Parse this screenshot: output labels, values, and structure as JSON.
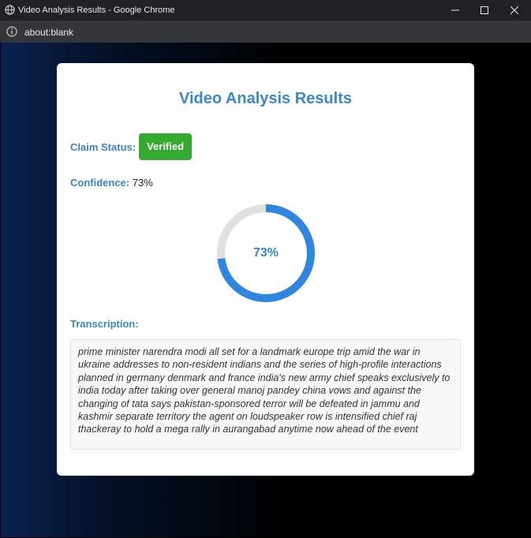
{
  "window": {
    "title": "Video Analysis Results - Google Chrome",
    "address": "about:blank"
  },
  "page": {
    "title": "Video Analysis Results",
    "claim_status_label": "Claim Status:",
    "claim_status_value": "Verified",
    "confidence_label": "Confidence:",
    "confidence_value": "73%",
    "confidence_fraction": 0.73,
    "donut_text": "73%",
    "transcription_label": "Transcription:",
    "transcription_text": "prime minister narendra modi all set for a landmark europe trip amid the war in ukraine addresses to non-resident indians and the series of high-profile interactions planned in germany denmark and france india's new army chief speaks exclusively to india today after taking over general manoj pandey china vows and against the changing of tata says pakistan-sponsored terror will be defeated in jammu and kashmir separate territory the agent on loudspeaker row is intensified chief raj thackeray to hold a mega rally in aurangabad anytime now ahead of the event"
  },
  "colors": {
    "accent": "#3b87cc",
    "verified": "#34aa2f",
    "ring_track": "#e0e0e0",
    "ring_fill": "#2f86e0"
  },
  "icons": {
    "window": "globe-icon",
    "address": "info-icon",
    "minimize": "minimize-icon",
    "maximize": "maximize-icon",
    "close": "close-icon"
  }
}
